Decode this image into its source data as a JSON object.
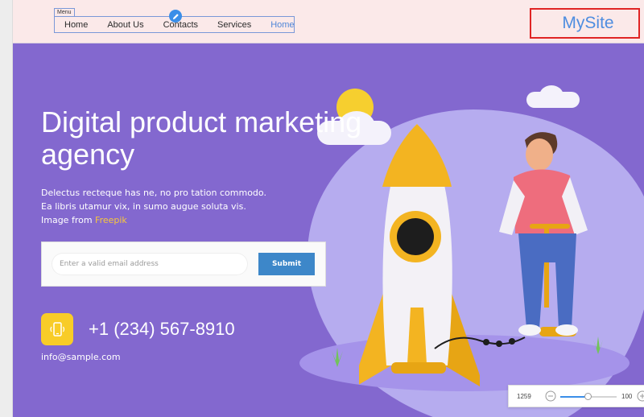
{
  "nav": {
    "menu_tag": "Menu",
    "items": [
      {
        "label": "Home"
      },
      {
        "label": "About Us"
      },
      {
        "label": "Contacts"
      },
      {
        "label": "Services"
      },
      {
        "label": "Home"
      }
    ]
  },
  "brand": {
    "name": "MySite"
  },
  "hero": {
    "headline": "Digital product marketing agency",
    "description_lines": [
      "Delectus recteque has ne, no pro tation commodo.",
      "Ea libris utamur vix, in sumo augue soluta vis."
    ],
    "image_credit_prefix": "Image from",
    "image_credit_link": "Freepik"
  },
  "signup": {
    "email_placeholder": "Enter a valid email address",
    "email_value": "",
    "submit_label": "Submit"
  },
  "contact": {
    "phone": "+1 (234) 567-8910",
    "email": "info@sample.com"
  },
  "zoom": {
    "width_value": "1259",
    "zoom_value": "100",
    "slider_fraction": 0.5
  },
  "colors": {
    "hero_bg": "#8368cf",
    "accent_yellow": "#f8cc28",
    "submit_blue": "#3d87c9",
    "brand_blue": "#4e8de0",
    "selection_red": "#e02424"
  },
  "icons": {
    "edit_badge": "pencil-icon",
    "phone_icon": "smartphone-icon",
    "zoom_out": "zoom-minus-icon",
    "zoom_in": "zoom-plus-icon"
  }
}
